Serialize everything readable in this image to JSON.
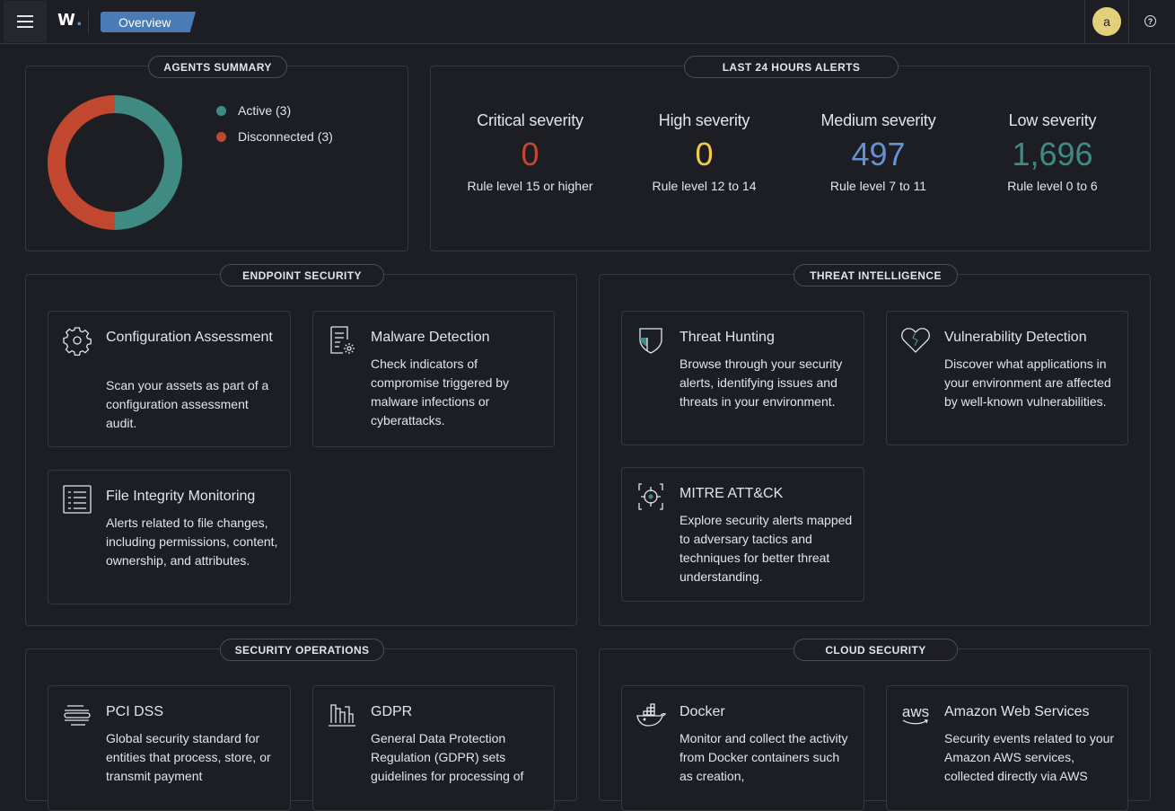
{
  "header": {
    "logo": "W",
    "logo_dot": ".",
    "breadcrumb": "Overview",
    "avatar_initial": "a",
    "help_glyph": "?"
  },
  "agents_summary": {
    "title": "AGENTS SUMMARY",
    "active_label": "Active (3)",
    "disconnected_label": "Disconnected (3)",
    "active_count": 3,
    "disconnected_count": 3,
    "colors": {
      "active": "#3f8b83",
      "disconnected": "#c2472f"
    }
  },
  "alerts": {
    "title": "LAST 24 HOURS ALERTS",
    "items": [
      {
        "title": "Critical severity",
        "value": "0",
        "sub": "Rule level 15 or higher",
        "color": "#c2472f"
      },
      {
        "title": "High severity",
        "value": "0",
        "sub": "Rule level 12 to 14",
        "color": "#f2c94c"
      },
      {
        "title": "Medium severity",
        "value": "497",
        "sub": "Rule level 7 to 11",
        "color": "#6690d0"
      },
      {
        "title": "Low severity",
        "value": "1,696",
        "sub": "Rule level 0 to 6",
        "color": "#3f8b83"
      }
    ]
  },
  "sections": {
    "endpoint": {
      "title": "ENDPOINT SECURITY",
      "cards": [
        {
          "title": "Configuration Assessment",
          "desc": "Scan your assets as part of a configuration assessment audit.",
          "icon": "gear-icon"
        },
        {
          "title": "Malware Detection",
          "desc": "Check indicators of compromise triggered by malware infections or cyberattacks.",
          "icon": "document-gear-icon"
        },
        {
          "title": "File Integrity Monitoring",
          "desc": "Alerts related to file changes, including permissions, content, ownership, and attributes.",
          "icon": "list-document-icon"
        }
      ]
    },
    "threat": {
      "title": "THREAT INTELLIGENCE",
      "cards": [
        {
          "title": "Threat Hunting",
          "desc": "Browse through your security alerts, identifying issues and threats in your environment.",
          "icon": "shield-icon"
        },
        {
          "title": "Vulnerability Detection",
          "desc": "Discover what applications in your environment are affected by well-known vulnerabilities.",
          "icon": "broken-heart-icon"
        },
        {
          "title": "MITRE ATT&CK",
          "desc": "Explore security alerts mapped to adversary tactics and techniques for better threat understanding.",
          "icon": "crosshair-icon"
        }
      ]
    },
    "secops": {
      "title": "SECURITY OPERATIONS",
      "cards": [
        {
          "title": "PCI DSS",
          "desc": "Global security standard for entities that process, store, or transmit payment",
          "icon": "card-lines-icon"
        },
        {
          "title": "GDPR",
          "desc": "General Data Protection Regulation (GDPR) sets guidelines for processing of",
          "icon": "columns-icon"
        }
      ]
    },
    "cloud": {
      "title": "CLOUD SECURITY",
      "cards": [
        {
          "title": "Docker",
          "desc": "Monitor and collect the activity from Docker containers such as creation,",
          "icon": "docker-icon"
        },
        {
          "title": "Amazon Web Services",
          "desc": "Security events related to your Amazon AWS services, collected directly via AWS",
          "icon": "aws-icon",
          "icon_text": "aws"
        }
      ]
    }
  }
}
